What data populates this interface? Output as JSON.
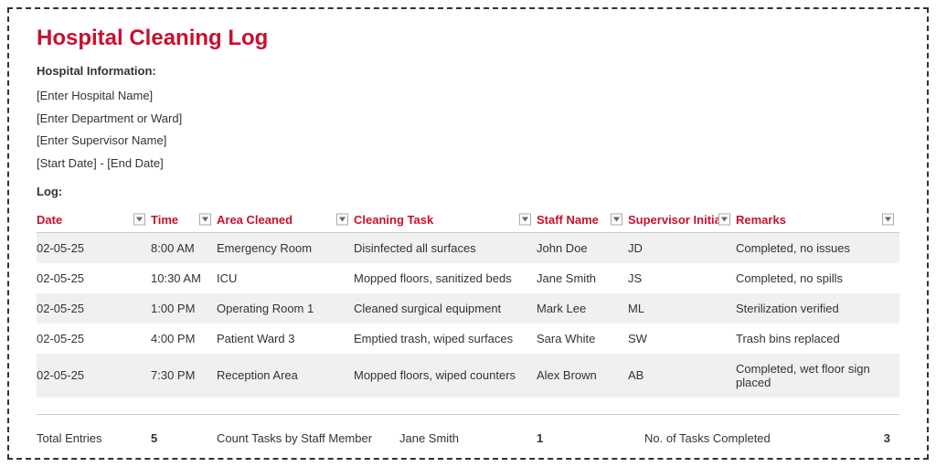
{
  "title": "Hospital Cleaning Log",
  "info_heading": "Hospital Information:",
  "info_lines": [
    "[Enter Hospital Name]",
    "[Enter Department or Ward]",
    "[Enter Supervisor Name]",
    "[Start Date] - [End Date]"
  ],
  "log_heading": "Log:",
  "columns": [
    "Date",
    "Time",
    "Area Cleaned",
    "Cleaning Task",
    "Staff Name",
    "Supervisor Initials",
    "Remarks"
  ],
  "rows": [
    {
      "date": "02-05-25",
      "time": "8:00 AM",
      "area": "Emergency Room",
      "task": "Disinfected all surfaces",
      "staff": "John Doe",
      "init": "JD",
      "remarks": "Completed, no issues"
    },
    {
      "date": "02-05-25",
      "time": "10:30 AM",
      "area": "ICU",
      "task": "Mopped floors, sanitized beds",
      "staff": "Jane Smith",
      "init": "JS",
      "remarks": "Completed, no spills"
    },
    {
      "date": "02-05-25",
      "time": "1:00 PM",
      "area": "Operating Room 1",
      "task": "Cleaned surgical equipment",
      "staff": "Mark Lee",
      "init": "ML",
      "remarks": "Sterilization verified"
    },
    {
      "date": "02-05-25",
      "time": "4:00 PM",
      "area": "Patient Ward 3",
      "task": "Emptied trash, wiped surfaces",
      "staff": "Sara White",
      "init": "SW",
      "remarks": "Trash bins replaced"
    },
    {
      "date": "02-05-25",
      "time": "7:30 PM",
      "area": "Reception Area",
      "task": "Mopped floors, wiped counters",
      "staff": "Alex Brown",
      "init": "AB",
      "remarks": "Completed, wet floor sign placed"
    }
  ],
  "summary": {
    "total_label": "Total Entries",
    "total_value": "5",
    "count_label": "Count Tasks by Staff Member",
    "count_staff": "Jane Smith",
    "count_value": "1",
    "completed_label": "No. of Tasks Completed",
    "completed_value": "3"
  }
}
